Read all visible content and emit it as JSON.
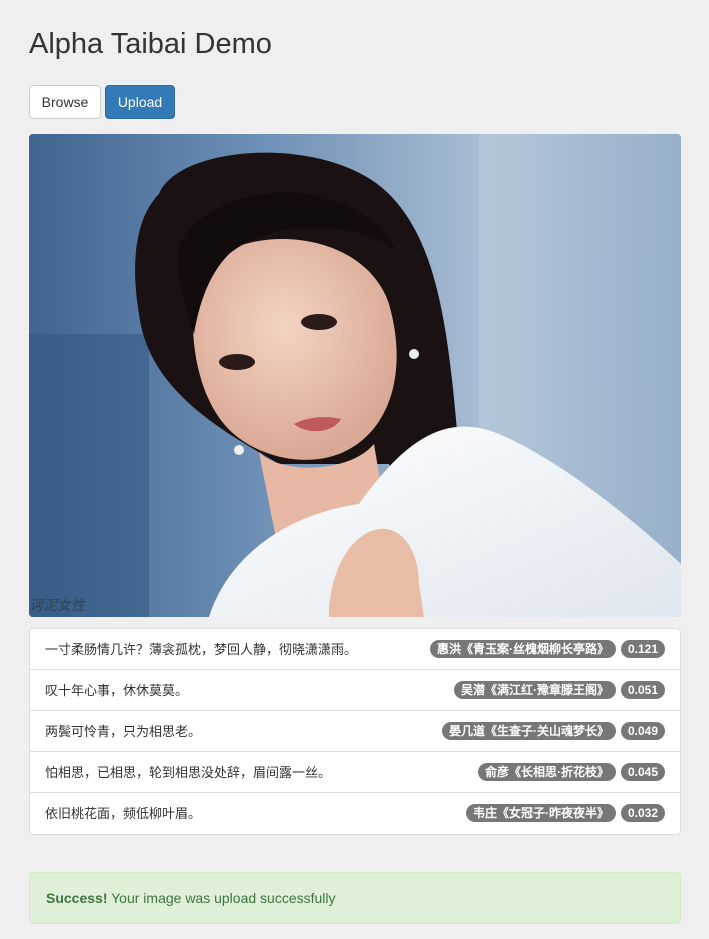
{
  "page": {
    "title": "Alpha Taibai Demo"
  },
  "toolbar": {
    "browse_label": "Browse",
    "upload_label": "Upload"
  },
  "image": {
    "watermark": "诃泥女性"
  },
  "results": [
    {
      "verse": "一寸柔肠情几许？薄衾孤枕，梦回人静，彻晓潇潇雨。",
      "source": "惠洪《青玉案·丝槐烟柳长亭路》",
      "score": "0.121"
    },
    {
      "verse": "叹十年心事，休休莫莫。",
      "source": "吴潜《满江红·豫章滕王阁》",
      "score": "0.051"
    },
    {
      "verse": "两鬓可怜青，只为相思老。",
      "source": "晏几道《生查子·关山魂梦长》",
      "score": "0.049"
    },
    {
      "verse": "怕相思，已相思，轮到相思没处辞，眉间露一丝。",
      "source": "俞彦《长相思·折花枝》",
      "score": "0.045"
    },
    {
      "verse": "依旧桃花面，频低柳叶眉。",
      "source": "韦庄《女冠子·昨夜夜半》",
      "score": "0.032"
    }
  ],
  "alert": {
    "strong": "Success!",
    "message": " Your image was upload successfully"
  },
  "colors": {
    "background": "#efefef",
    "primary": "#337ab7",
    "badge": "#777777",
    "success_bg": "#dff0d8",
    "success_text": "#3c763d"
  }
}
